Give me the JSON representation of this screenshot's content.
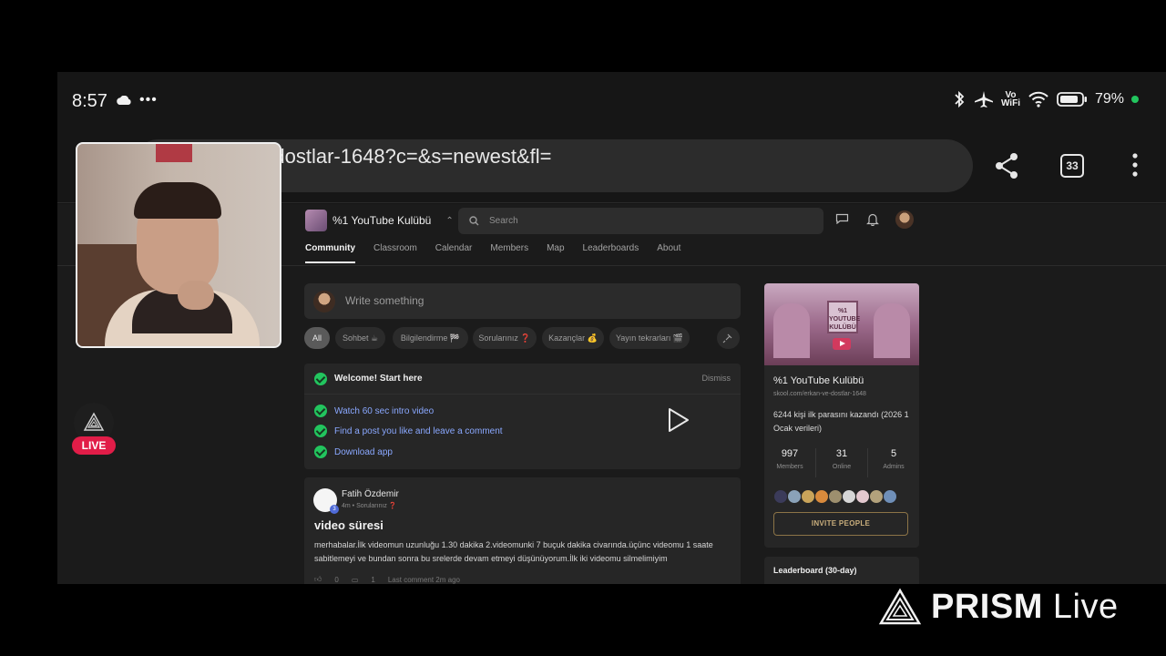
{
  "statusbar": {
    "time": "8:57",
    "vowifi": [
      "Vo",
      "WiFi"
    ],
    "battery": "79%"
  },
  "browser": {
    "url": "kan-ve-dostlar-1648?c=&s=newest&fl=",
    "tab_count": "33"
  },
  "header": {
    "group_name": "%1 YouTube Kulübü",
    "search_placeholder": "Search"
  },
  "nav": {
    "tabs": [
      "Community",
      "Classroom",
      "Calendar",
      "Members",
      "Map",
      "Leaderboards",
      "About"
    ]
  },
  "composer": {
    "placeholder": "Write something"
  },
  "chips": [
    "All",
    "Sohbet ☕",
    "Bilgilendirme 🏁",
    "Sorularınız ❓",
    "Kazançlar 💰",
    "Yayın tekrarları 🎬"
  ],
  "welcome": {
    "title": "Welcome! Start here",
    "dismiss": "Dismiss",
    "tasks": [
      "Watch 60 sec intro video",
      "Find a post you like and leave a comment",
      "Download app"
    ]
  },
  "post": {
    "author": "Fatih Özdemir",
    "level": "3",
    "meta": "4m • Sorularınız ❓",
    "title": "video süresi",
    "body": "merhabalar.İlk videomun uzunluğu 1.30 dakika 2.videomunki 7 buçuk dakika civarında.üçünc videomu 1 saate sabitlemeyi ve bundan sonra bu srelerde devam etmeyi düşünüyorum.İlk iki videomu silmelimiyim",
    "likes": "0",
    "comments": "1",
    "last_comment": "Last comment 2m ago"
  },
  "sidebar": {
    "cover_text": "%1 YOUTUBE KULÜBÜ",
    "name": "%1 YouTube Kulübü",
    "url": "skool.com/erkan-ve-dostlar-1648",
    "description": "6244 kişi ilk parasını kazandı (2026 1 Ocak verileri)",
    "stats": [
      {
        "value": "997",
        "label": "Members"
      },
      {
        "value": "31",
        "label": "Online"
      },
      {
        "value": "5",
        "label": "Admins"
      }
    ],
    "member_avatar_colors": [
      "#3b3b5a",
      "#8aa2b8",
      "#c9a45a",
      "#d88a3c",
      "#9d8f6e",
      "#d6d6d6",
      "#e3c8cf",
      "#b3a27c",
      "#6f8fb8"
    ],
    "invite_label": "INVITE PEOPLE",
    "leaderboard_title": "Leaderboard (30-day)"
  },
  "overlay": {
    "live_label": "LIVE",
    "prism_brand": "PRISM",
    "prism_suffix": "Live"
  }
}
